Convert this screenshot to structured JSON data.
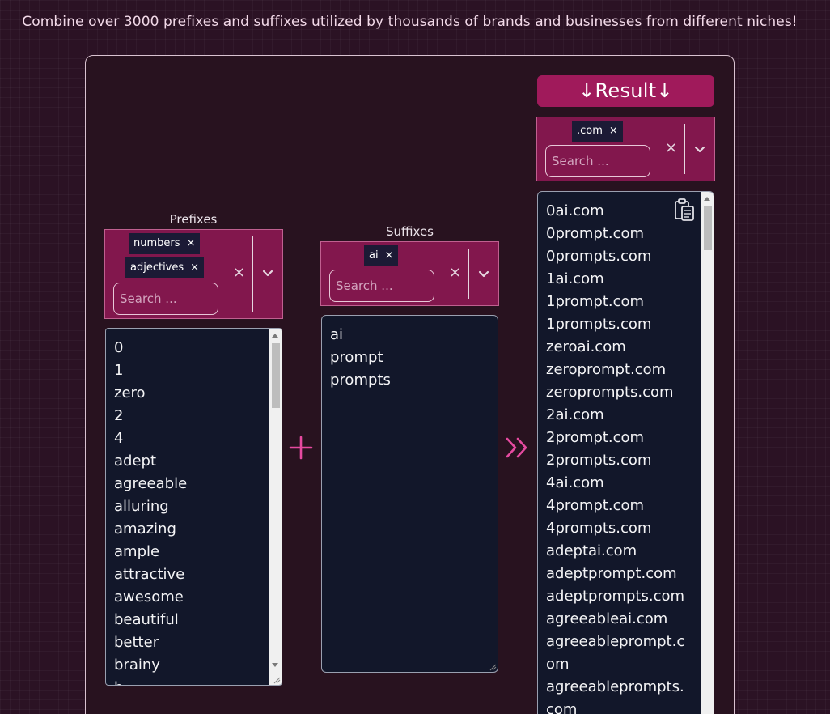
{
  "tagline": "Combine over 3000 prefixes and suffixes utilized by thousands of brands and businesses from different niches!",
  "prefixes": {
    "label": "Prefixes",
    "selected_tags": [
      "numbers",
      "adjectives"
    ],
    "search_placeholder": "Search ...",
    "items": [
      "0",
      "1",
      "zero",
      "2",
      "4",
      "adept",
      "agreeable",
      "alluring",
      "amazing",
      "ample",
      "attractive",
      "awesome",
      "beautiful",
      "better",
      "brainy",
      "b..."
    ]
  },
  "suffixes": {
    "label": "Suffixes",
    "selected_tags": [
      "ai"
    ],
    "search_placeholder": "Search ...",
    "items": [
      "ai",
      "prompt",
      "prompts"
    ]
  },
  "result": {
    "button_label": "↓Result↓",
    "selected_tags": [
      ".com"
    ],
    "search_placeholder": "Search ...",
    "items": [
      "0ai.com",
      "0prompt.com",
      "0prompts.com",
      "1ai.com",
      "1prompt.com",
      "1prompts.com",
      "zeroai.com",
      "zeroprompt.com",
      "zeroprompts.com",
      "2ai.com",
      "2prompt.com",
      "2prompts.com",
      "4ai.com",
      "4prompt.com",
      "4prompts.com",
      "adeptai.com",
      "adeptprompt.com",
      "adeptprompts.com",
      "agreeableai.com",
      "agreeableprompt.c",
      "om",
      "agreeableprompts.",
      "com"
    ]
  },
  "icons": {
    "remove_tag": "×",
    "clear": "×",
    "combine": "plus-icon",
    "output": "double-chevron-right-icon",
    "copy": "clipboard-icon"
  },
  "colors": {
    "background": "#2b1224",
    "accent": "#82174d",
    "button": "#a01a5b",
    "list_bg": "#12172a",
    "icon_pink": "#e64aa0"
  }
}
